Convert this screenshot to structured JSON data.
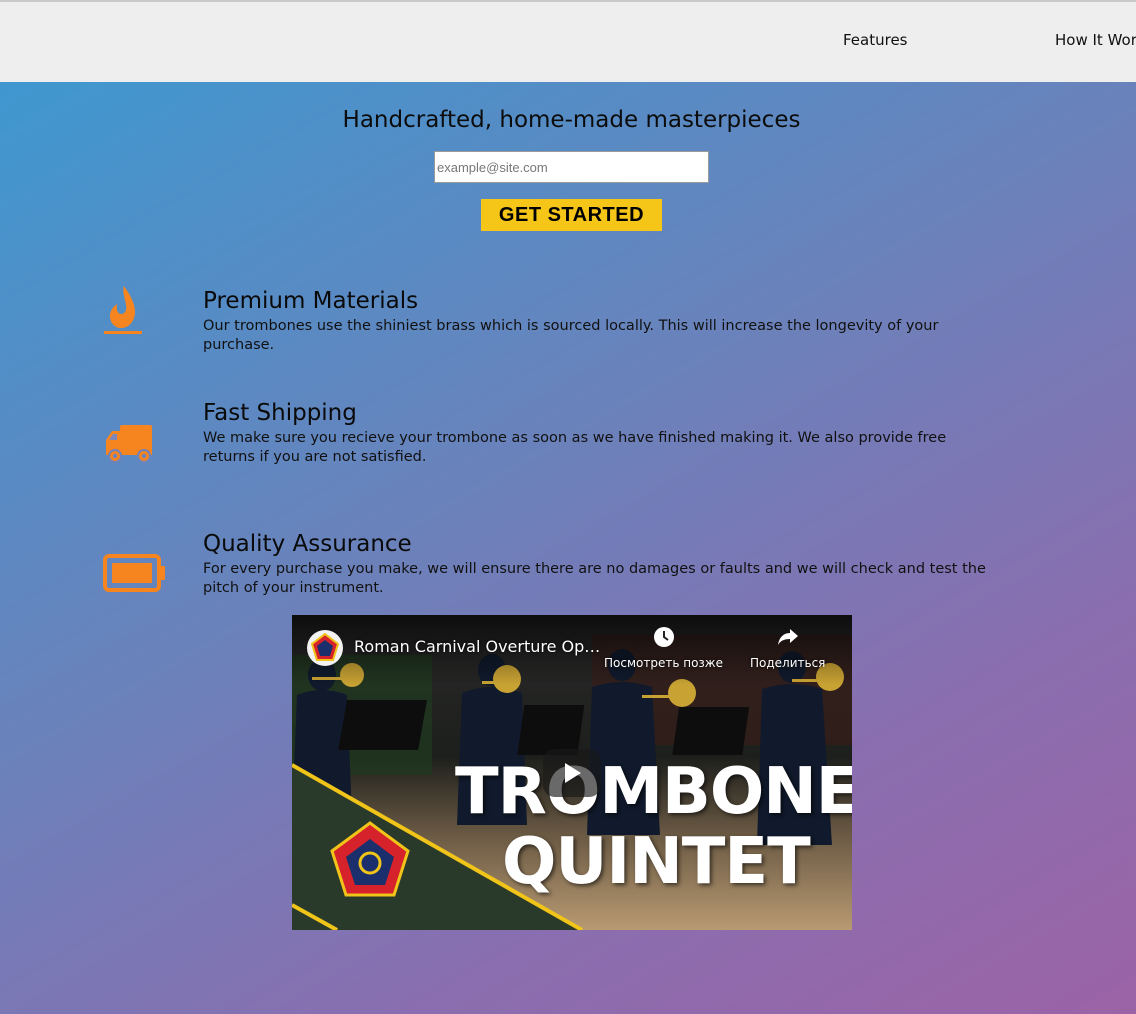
{
  "nav": {
    "features": "Features",
    "how_it_works": "How It Wor"
  },
  "hero": {
    "title": "Handcrafted, home-made masterpieces",
    "email_placeholder": "example@site.com",
    "button": "GET STARTED"
  },
  "features": [
    {
      "icon": "flame-icon",
      "title": "Premium Materials",
      "text": "Our trombones use the shiniest brass which is sourced locally. This will increase the longevity of your purchase."
    },
    {
      "icon": "truck-icon",
      "title": "Fast Shipping",
      "text": "We make sure you recieve your trombone as soon as we have finished making it. We also provide free returns if you are not satisfied."
    },
    {
      "icon": "battery-icon",
      "title": "Quality Assurance",
      "text": "For every purchase you make, we will ensure there are no damages or faults and we will check and test the pitch of your instrument."
    }
  ],
  "video": {
    "title": "Roman Carnival Overture Op…",
    "watch_later": "Посмотреть позже",
    "share": "Поделиться",
    "overlay_line1": "TROMBONE",
    "overlay_line2": "QUINTET"
  },
  "colors": {
    "accent_button": "#f5c518",
    "icon_orange": "#f7851f",
    "topbar": "#eeeeee"
  }
}
